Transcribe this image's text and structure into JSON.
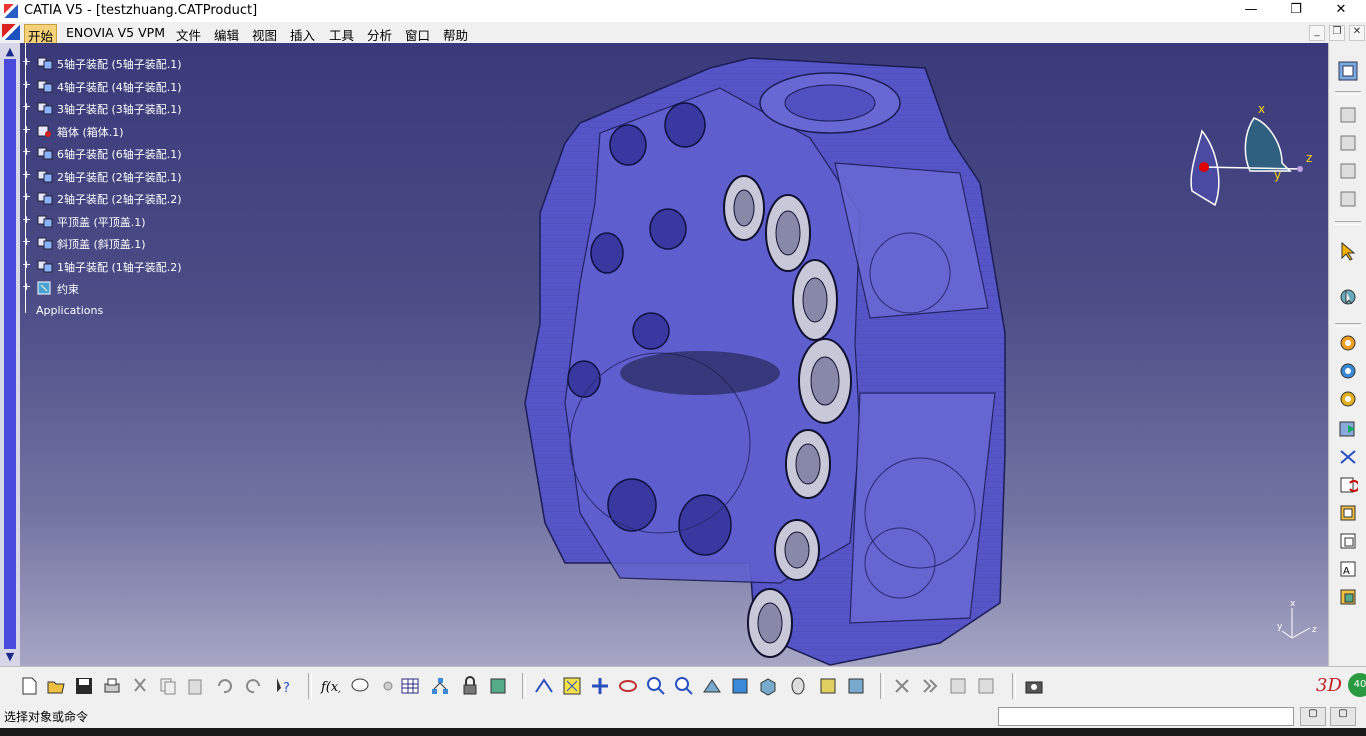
{
  "window": {
    "title": "CATIA V5 - [testzhuang.CATProduct]",
    "minimize_glyph": "—",
    "restore_glyph": "❐",
    "close_glyph": "✕"
  },
  "menu": {
    "items": [
      "开始",
      "ENOVIA V5 VPM",
      "文件",
      "编辑",
      "视图",
      "插入",
      "工具",
      "分析",
      "窗口",
      "帮助"
    ],
    "active": "开始",
    "mdi_min": "_",
    "mdi_restore": "❐",
    "mdi_close": "✕"
  },
  "tree": {
    "items": [
      {
        "label": "5轴子装配 (5轴子装配.1)",
        "icon": "assembly-icon"
      },
      {
        "label": "4轴子装配 (4轴子装配.1)",
        "icon": "assembly-icon"
      },
      {
        "label": "3轴子装配 (3轴子装配.1)",
        "icon": "assembly-icon"
      },
      {
        "label": "箱体 (箱体.1)",
        "icon": "part-icon"
      },
      {
        "label": "6轴子装配 (6轴子装配.1)",
        "icon": "assembly-icon"
      },
      {
        "label": "2轴子装配 (2轴子装配.1)",
        "icon": "assembly-icon"
      },
      {
        "label": "2轴子装配 (2轴子装配.2)",
        "icon": "assembly-icon"
      },
      {
        "label": "平顶盖 (平顶盖.1)",
        "icon": "assembly-icon"
      },
      {
        "label": "斜顶盖 (斜顶盖.1)",
        "icon": "assembly-icon"
      },
      {
        "label": "1轴子装配 (1轴子装配.2)",
        "icon": "assembly-icon"
      },
      {
        "label": "约束",
        "icon": "constraints-icon"
      },
      {
        "label": "Applications",
        "icon": "applications-icon"
      }
    ]
  },
  "compass": {
    "x": "x",
    "y": "y",
    "z": "z"
  },
  "axis_triad": {
    "x": "x",
    "y": "y",
    "z": "z"
  },
  "status": {
    "prompt": "选择对象或命令",
    "command_value": "",
    "badge": "40"
  },
  "right_toolbar": {
    "icons": [
      "product-icon",
      "bill-icon",
      "clash-icon",
      "measure-icon",
      "section-icon",
      "select-icon",
      "compass-tool-icon",
      "existing-component-icon",
      "new-product-icon",
      "new-component-icon",
      "new-part-icon",
      "replace-icon",
      "graph-tree-icon",
      "generate-numbering-icon",
      "fast-multi-instance-icon",
      "reorder-icon",
      "catalog-icon",
      "text-annotation-icon",
      "scene-icon"
    ]
  },
  "bottom_toolbar": {
    "icons": [
      "new-icon",
      "open-icon",
      "save-icon",
      "print-icon",
      "cut-icon",
      "copy-icon",
      "paste-icon",
      "undo-icon",
      "redo-icon",
      "whats-this-icon",
      "formula-icon",
      "comment-icon",
      "knowledge-icon",
      "table-icon",
      "hierarchy-icon",
      "lock-icon",
      "spreadsheet-icon",
      "fly-icon",
      "fit-all-icon",
      "pan-icon",
      "rotate-icon",
      "zoom-in-icon",
      "zoom-out-icon",
      "normal-view-icon",
      "iso-view-icon",
      "view-cube-icon",
      "shading-icon",
      "hide-show-icon",
      "swap-space-icon",
      "render-icon",
      "arrange-icon",
      "next-icon",
      "bom-icon",
      "bom2-icon",
      "capture-icon"
    ]
  },
  "colors": {
    "viewport_top": "#3a3a7a",
    "viewport_bottom": "#a6a6c4",
    "menu_active": "#f5d27a",
    "model_blue": "#5555c8"
  }
}
